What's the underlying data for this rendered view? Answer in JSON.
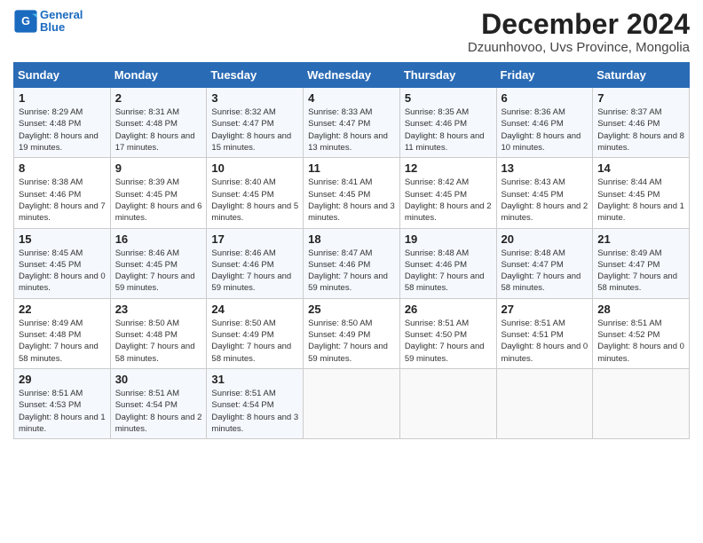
{
  "logo": {
    "line1": "General",
    "line2": "Blue"
  },
  "title": "December 2024",
  "subtitle": "Dzuunhovoo, Uvs Province, Mongolia",
  "headers": [
    "Sunday",
    "Monday",
    "Tuesday",
    "Wednesday",
    "Thursday",
    "Friday",
    "Saturday"
  ],
  "weeks": [
    [
      {
        "day": "1",
        "info": "Sunrise: 8:29 AM\nSunset: 4:48 PM\nDaylight: 8 hours and 19 minutes."
      },
      {
        "day": "2",
        "info": "Sunrise: 8:31 AM\nSunset: 4:48 PM\nDaylight: 8 hours and 17 minutes."
      },
      {
        "day": "3",
        "info": "Sunrise: 8:32 AM\nSunset: 4:47 PM\nDaylight: 8 hours and 15 minutes."
      },
      {
        "day": "4",
        "info": "Sunrise: 8:33 AM\nSunset: 4:47 PM\nDaylight: 8 hours and 13 minutes."
      },
      {
        "day": "5",
        "info": "Sunrise: 8:35 AM\nSunset: 4:46 PM\nDaylight: 8 hours and 11 minutes."
      },
      {
        "day": "6",
        "info": "Sunrise: 8:36 AM\nSunset: 4:46 PM\nDaylight: 8 hours and 10 minutes."
      },
      {
        "day": "7",
        "info": "Sunrise: 8:37 AM\nSunset: 4:46 PM\nDaylight: 8 hours and 8 minutes."
      }
    ],
    [
      {
        "day": "8",
        "info": "Sunrise: 8:38 AM\nSunset: 4:46 PM\nDaylight: 8 hours and 7 minutes."
      },
      {
        "day": "9",
        "info": "Sunrise: 8:39 AM\nSunset: 4:45 PM\nDaylight: 8 hours and 6 minutes."
      },
      {
        "day": "10",
        "info": "Sunrise: 8:40 AM\nSunset: 4:45 PM\nDaylight: 8 hours and 5 minutes."
      },
      {
        "day": "11",
        "info": "Sunrise: 8:41 AM\nSunset: 4:45 PM\nDaylight: 8 hours and 3 minutes."
      },
      {
        "day": "12",
        "info": "Sunrise: 8:42 AM\nSunset: 4:45 PM\nDaylight: 8 hours and 2 minutes."
      },
      {
        "day": "13",
        "info": "Sunrise: 8:43 AM\nSunset: 4:45 PM\nDaylight: 8 hours and 2 minutes."
      },
      {
        "day": "14",
        "info": "Sunrise: 8:44 AM\nSunset: 4:45 PM\nDaylight: 8 hours and 1 minute."
      }
    ],
    [
      {
        "day": "15",
        "info": "Sunrise: 8:45 AM\nSunset: 4:45 PM\nDaylight: 8 hours and 0 minutes."
      },
      {
        "day": "16",
        "info": "Sunrise: 8:46 AM\nSunset: 4:45 PM\nDaylight: 7 hours and 59 minutes."
      },
      {
        "day": "17",
        "info": "Sunrise: 8:46 AM\nSunset: 4:46 PM\nDaylight: 7 hours and 59 minutes."
      },
      {
        "day": "18",
        "info": "Sunrise: 8:47 AM\nSunset: 4:46 PM\nDaylight: 7 hours and 59 minutes."
      },
      {
        "day": "19",
        "info": "Sunrise: 8:48 AM\nSunset: 4:46 PM\nDaylight: 7 hours and 58 minutes."
      },
      {
        "day": "20",
        "info": "Sunrise: 8:48 AM\nSunset: 4:47 PM\nDaylight: 7 hours and 58 minutes."
      },
      {
        "day": "21",
        "info": "Sunrise: 8:49 AM\nSunset: 4:47 PM\nDaylight: 7 hours and 58 minutes."
      }
    ],
    [
      {
        "day": "22",
        "info": "Sunrise: 8:49 AM\nSunset: 4:48 PM\nDaylight: 7 hours and 58 minutes."
      },
      {
        "day": "23",
        "info": "Sunrise: 8:50 AM\nSunset: 4:48 PM\nDaylight: 7 hours and 58 minutes."
      },
      {
        "day": "24",
        "info": "Sunrise: 8:50 AM\nSunset: 4:49 PM\nDaylight: 7 hours and 58 minutes."
      },
      {
        "day": "25",
        "info": "Sunrise: 8:50 AM\nSunset: 4:49 PM\nDaylight: 7 hours and 59 minutes."
      },
      {
        "day": "26",
        "info": "Sunrise: 8:51 AM\nSunset: 4:50 PM\nDaylight: 7 hours and 59 minutes."
      },
      {
        "day": "27",
        "info": "Sunrise: 8:51 AM\nSunset: 4:51 PM\nDaylight: 8 hours and 0 minutes."
      },
      {
        "day": "28",
        "info": "Sunrise: 8:51 AM\nSunset: 4:52 PM\nDaylight: 8 hours and 0 minutes."
      }
    ],
    [
      {
        "day": "29",
        "info": "Sunrise: 8:51 AM\nSunset: 4:53 PM\nDaylight: 8 hours and 1 minute."
      },
      {
        "day": "30",
        "info": "Sunrise: 8:51 AM\nSunset: 4:54 PM\nDaylight: 8 hours and 2 minutes."
      },
      {
        "day": "31",
        "info": "Sunrise: 8:51 AM\nSunset: 4:54 PM\nDaylight: 8 hours and 3 minutes."
      },
      {
        "day": "",
        "info": ""
      },
      {
        "day": "",
        "info": ""
      },
      {
        "day": "",
        "info": ""
      },
      {
        "day": "",
        "info": ""
      }
    ]
  ]
}
